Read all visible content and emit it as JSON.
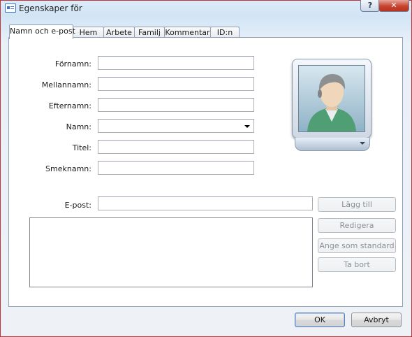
{
  "window": {
    "title": "Egenskaper för"
  },
  "titlebar": {
    "help_label": "?",
    "close_label": "✕"
  },
  "tabs": [
    {
      "label": "Namn och e-post",
      "active": true
    },
    {
      "label": "Hem"
    },
    {
      "label": "Arbete"
    },
    {
      "label": "Familj"
    },
    {
      "label": "Kommentar"
    },
    {
      "label": "ID:n"
    }
  ],
  "form": {
    "first_name_label": "Förnamn:",
    "first_name_value": "",
    "middle_name_label": "Mellannamn:",
    "middle_name_value": "",
    "last_name_label": "Efternamn:",
    "last_name_value": "",
    "display_name_label": "Namn:",
    "display_name_value": "",
    "title_label": "Titel:",
    "title_value": "",
    "nickname_label": "Smeknamn:",
    "nickname_value": "",
    "email_label": "E-post:",
    "email_value": ""
  },
  "email_buttons": {
    "add": "Lägg till",
    "edit": "Redigera",
    "set_default": "Ange som standard",
    "remove": "Ta bort"
  },
  "footer": {
    "ok": "OK",
    "cancel": "Avbryt"
  },
  "icons": {
    "title_icon": "contact-card-icon",
    "photo": "contact-picture-icon"
  }
}
